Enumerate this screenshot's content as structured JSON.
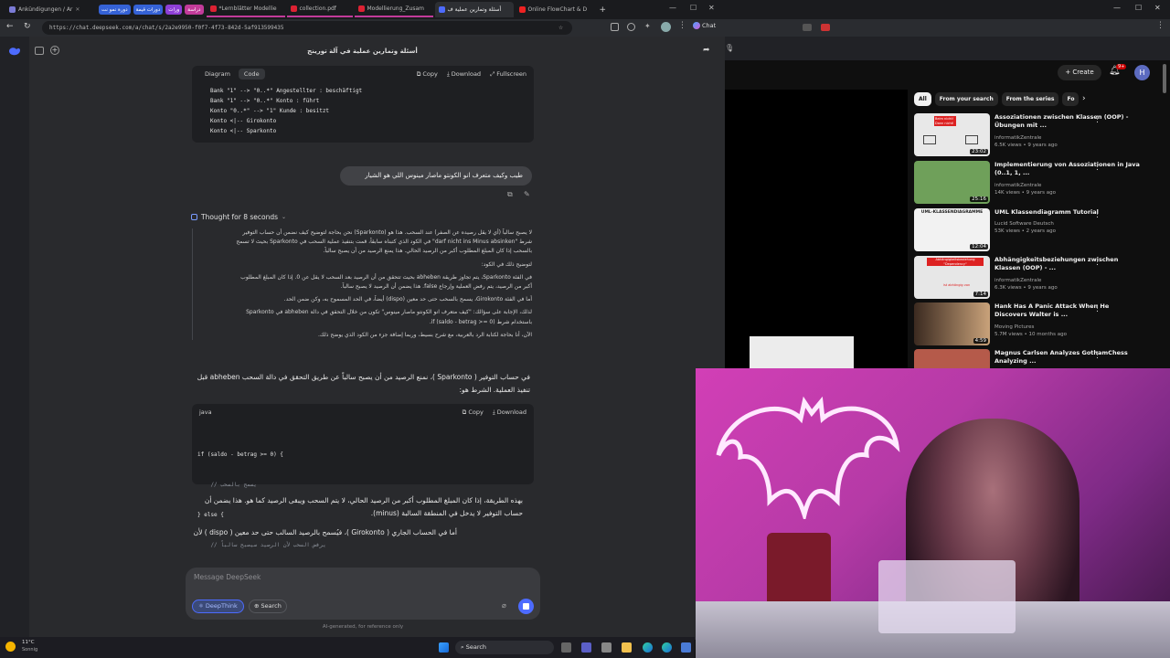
{
  "tabs": [
    {
      "label": "Ankündigungen / Ar",
      "fav": "#7b7bd6",
      "active": false
    },
    {
      "label": "*Lernblätter Modellie",
      "fav": "#d23",
      "active": false
    },
    {
      "label": "collection.pdf",
      "fav": "#d23",
      "active": false
    },
    {
      "label": "Modellierung_Zusam",
      "fav": "#d23",
      "active": false
    },
    {
      "label": "أسئلة وتمارين عملية ف",
      "fav": "#4d6bfe",
      "active": true
    },
    {
      "label": "Online FlowChart & D",
      "fav": "#e22",
      "active": false
    }
  ],
  "tab_groups": [
    {
      "label": "دورة نمو نت",
      "color": "#3562d6"
    },
    {
      "label": "دورات قيمة",
      "color": "#3562d6"
    },
    {
      "label": "ورات",
      "color": "#8e3fd6"
    },
    {
      "label": "دراسة",
      "color": "#c23b9a"
    }
  ],
  "address": {
    "url": "https://chat.deepseek.com/a/chat/s/2a2e9950-f0f7-4f73-842d-5af913599435",
    "chat_label": "Chat"
  },
  "chat": {
    "title": "أسئلة وتمارين عملية في آلة تورينج",
    "diagram_tab": "Diagram",
    "code_tab": "Code",
    "copy": "Copy",
    "download": "Download",
    "fullscreen": "Fullscreen",
    "diagram_code": [
      "Bank \"1\" --> \"0..*\" Angestellter : beschäftigt",
      "Bank \"1\" --> \"0..*\" Konto : führt",
      "Konto \"0..*\" --> \"1\" Kunde : besitzt",
      "Konto <|-- Girokonto",
      "Konto <|-- Sparkonto"
    ],
    "user_message": "طيب وكيف متعرف انو الكونتو ماصار مينوس اللي هو الشيار",
    "thought": "Thought for 8 seconds",
    "thinking": [
      "لا يصبح سالباً (أي لا يقل رصيده عن الصفر) عند السحب. هذا هو (Sparkonto) نحن بحاجة لتوضيح كيف نضمن أن حساب التوفير",
      "شرط \"darf nicht ins Minus absinken\" في الكود الذي كتبناه سابقاً، قمت بتنفيذ عملية السحب في Sparkonto بحيث لا تسمح",
      "بالسحب إذا كان المبلغ المطلوب أكبر من الرصيد الحالي. هذا يمنع الرصيد من أن يصبح سالباً.",
      "لتوضيح ذلك في الكود:",
      "في الفئة Sparkonto، يتم تجاوز طريقة abheben بحيث تتحقق من أن الرصيد بعد السحب لا يقل عن 0. إذا كان المبلغ المطلوب",
      "أكبر من الرصيد، يتم رفض العملية وإرجاع false. هذا يضمن أن الرصيد لا يصبح سالباً.",
      "أما في الفئة Girokonto، يسمح بالسحب حتى حد معين (dispo) أيضاً، في الحد المسموح به، وكن ضمن الحد.",
      "لذلك، الإجابة على سؤالك: \"كيف متعرف انو الكونتو ماصار مينوس\" تكون من خلال التحقق في دالة abheben في Sparkonto",
      "باستخدام شرط if (saldo - betrag >= 0).",
      "الآن، أنا بحاجة لكتابة الرد بالعربية، مع شرح بسيط، وربما إضافة جزء من الكود الذي يوضح ذلك."
    ],
    "answer_p1a": "في حساب التوفير ( Sparkonto )، نمنع الرصيد من أن يصبح سالباً عن طريق التحقق في دالة السحب abheben قبل",
    "answer_p1b": "تنفيذ العملية. الشرط هو:",
    "code_lang": "java",
    "java_code": [
      "if (saldo - betrag >= 0) {",
      "    // يسمح بالسحب",
      "} else {",
      "    // يرفض السحب لأن الرصيد سيصبح سالباً",
      "}"
    ],
    "answer_p2a": "بهذه الطريقة، إذا كان المبلغ المطلوب أكبر من الرصيد الحالي، لا يتم السحب ويبقى الرصيد كما هو. هذا يضمن أن",
    "answer_p2b": "حساب التوفير لا يدخل في المنطقة السالبة (minus).",
    "answer_p3": "أما في الحساب الجاري ( Girokonto )، فيُسمح بالرصيد السالب حتى حد معين ( dispo ) لأن",
    "composer_placeholder": "Message DeepSeek",
    "deepthink": "DeepThink",
    "search": "Search",
    "disclaimer": "AI-generated, for reference only"
  },
  "youtube": {
    "create": "Create",
    "notif_count": "9+",
    "avatar": "H",
    "chips": [
      "All",
      "From your search",
      "From the series",
      "Fo"
    ],
    "videos": [
      {
        "title": "Assoziationen zwischen Klassen (OOP) - Übungen mit ...",
        "channel": "informatikZentrale",
        "meta": "6.5K views • 9 years ago",
        "duration": "23:02",
        "thumb": "#e8e8e8"
      },
      {
        "title": "Implementierung von Assoziationen in Java (0..1, 1, ...",
        "channel": "informatikZentrale",
        "meta": "14K views • 9 years ago",
        "duration": "25:16",
        "thumb": "#6fa05a"
      },
      {
        "title": "UML Klassendiagramm Tutorial",
        "channel": "Lucid Software Deutsch",
        "meta": "53K views • 2 years ago",
        "duration": "12:04",
        "thumb": "#f2f2f2"
      },
      {
        "title": "Abhängigkeitsbeziehungen zwischen Klassen (OOP) - ...",
        "channel": "informatikZentrale",
        "meta": "6.3K views • 9 years ago",
        "duration": "7:14",
        "thumb": "#e7e7e7"
      },
      {
        "title": "Hank Has A Panic Attack When He Discovers Walter is ...",
        "channel": "Moving Pictures",
        "meta": "5.7M views • 10 months ago",
        "duration": "4:59",
        "thumb": "#8a6a4a"
      },
      {
        "title": "Magnus Carlsen Analyzes GothamChess Analyzing ...",
        "channel": "",
        "meta": "",
        "duration": "",
        "thumb": "#b55a4a"
      }
    ],
    "thumb_labels": [
      "Beim nicht! Dann nicht!",
      "UML-KLASSENDIAGRAMME",
      "Abhängigkeitsbeziehung \"Dependency\"",
      "ist abhängig von"
    ]
  },
  "taskbar": {
    "weather": "11°C",
    "weather_desc": "Sonnig",
    "search": "Search"
  }
}
